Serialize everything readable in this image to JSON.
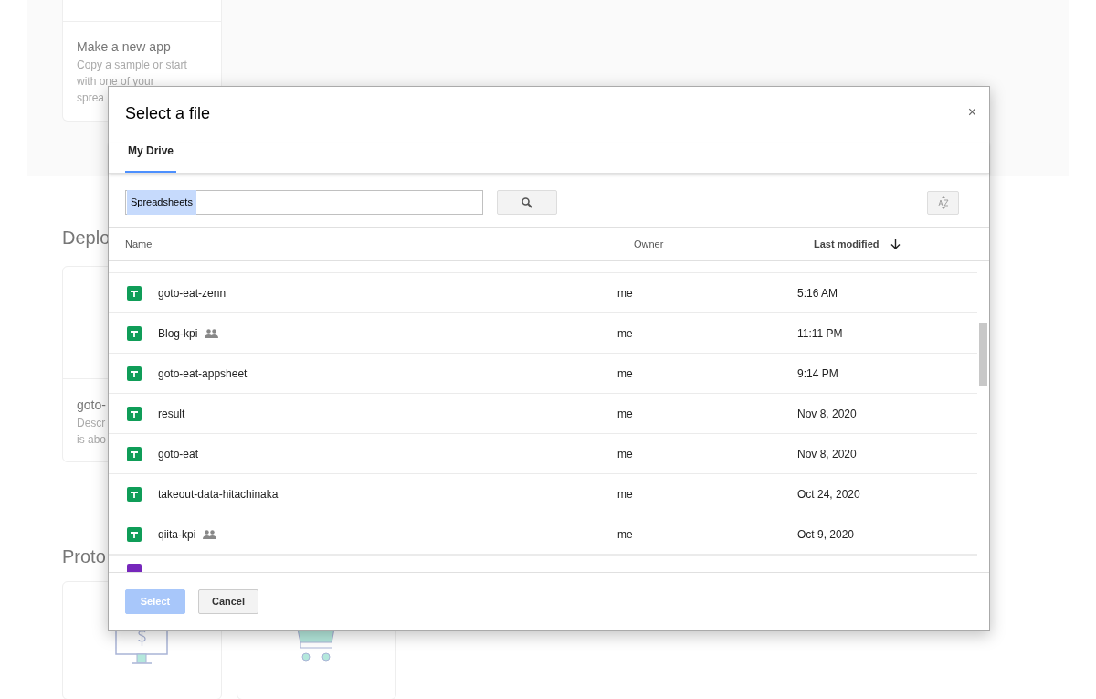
{
  "background": {
    "new_app_card": {
      "title": "Make a new app",
      "description": [
        "Copy a sample or start",
        "with one of your",
        "sprea"
      ]
    },
    "sections": [
      {
        "heading": "Deplo",
        "card": {
          "title": "goto-",
          "description": [
            "Descr",
            "is abo"
          ]
        }
      },
      {
        "heading": "Proto"
      }
    ]
  },
  "dialog": {
    "title": "Select a file",
    "close": "×",
    "tabs": [
      {
        "label": "My Drive",
        "selected": true
      }
    ],
    "search": {
      "value": "Spreadsheets",
      "selected_text": true
    },
    "columns": [
      {
        "label": "Name",
        "sorted": false
      },
      {
        "label": "Owner",
        "sorted": false
      },
      {
        "label": "Last modified",
        "sorted": true
      }
    ],
    "rows": [
      {
        "kind": "sheet",
        "name": "goto-eat-zenn",
        "shared": false,
        "owner": "me",
        "modified": "5:16 AM"
      },
      {
        "kind": "sheet",
        "name": "Blog-kpi",
        "shared": true,
        "owner": "me",
        "modified": "11:11 PM"
      },
      {
        "kind": "sheet",
        "name": "goto-eat-appsheet",
        "shared": false,
        "owner": "me",
        "modified": "9:14 PM"
      },
      {
        "kind": "sheet",
        "name": "result",
        "shared": false,
        "owner": "me",
        "modified": "Nov 8, 2020"
      },
      {
        "kind": "sheet",
        "name": "goto-eat",
        "shared": false,
        "owner": "me",
        "modified": "Nov 8, 2020"
      },
      {
        "kind": "sheet",
        "name": "takeout-data-hitachinaka",
        "shared": false,
        "owner": "me",
        "modified": "Oct 24, 2020"
      },
      {
        "kind": "sheet",
        "name": "qiita-kpi",
        "shared": true,
        "owner": "me",
        "modified": "Oct 9, 2020"
      },
      {
        "kind": "form"
      }
    ],
    "buttons": [
      {
        "label": "Select",
        "kind": "primary",
        "disabled": true
      },
      {
        "label": "Cancel",
        "kind": "secondary",
        "disabled": false
      }
    ]
  }
}
